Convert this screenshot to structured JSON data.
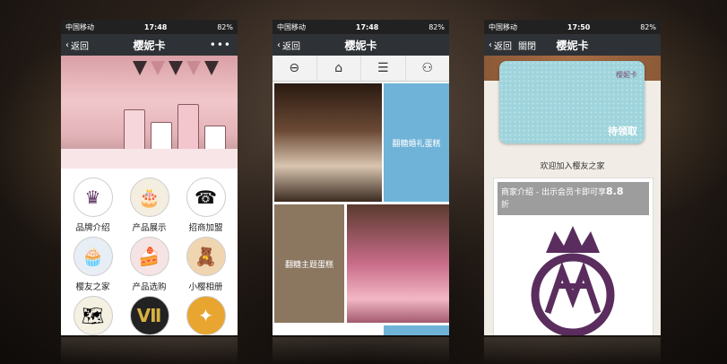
{
  "status": {
    "carrier": "中国移动",
    "battery": "82%",
    "time1": "17:48",
    "time2": "17:48",
    "time3": "17:50"
  },
  "nav": {
    "back": "返回",
    "title": "樱妮卡",
    "more": "•••",
    "close": "關閉"
  },
  "grid_items": [
    {
      "label": "品牌介绍",
      "icon": "crown-logo-icon"
    },
    {
      "label": "产品展示",
      "icon": "cake-icon"
    },
    {
      "label": "招商加盟",
      "icon": "telephone-icon"
    },
    {
      "label": "樱友之家",
      "icon": "cupcake-icon"
    },
    {
      "label": "产品选购",
      "icon": "gift-cake-icon"
    },
    {
      "label": "小樱相册",
      "icon": "teddy-bear-icon"
    }
  ],
  "toolbar": [
    {
      "icon": "back-circle-icon",
      "glyph": "⊖"
    },
    {
      "icon": "home-icon",
      "glyph": "⌂"
    },
    {
      "icon": "list-icon",
      "glyph": "☰"
    },
    {
      "icon": "user-icon",
      "glyph": "⚇"
    }
  ],
  "tiles": {
    "t1": "翻糖婚礼蛋糕",
    "t2": "翻糖主题蛋糕"
  },
  "card": {
    "brand": "樱妮卡",
    "tag": "待领取",
    "welcome": "欢迎加入樱友之家",
    "info_prefix": "商家介绍 - 出示会员卡即可享",
    "info_discount": "8.8",
    "info_suffix": "折"
  },
  "colors": {
    "tile_blue": "#6fb3d8",
    "tile_brown": "#8b7660",
    "accent": "#5a2d5e"
  }
}
